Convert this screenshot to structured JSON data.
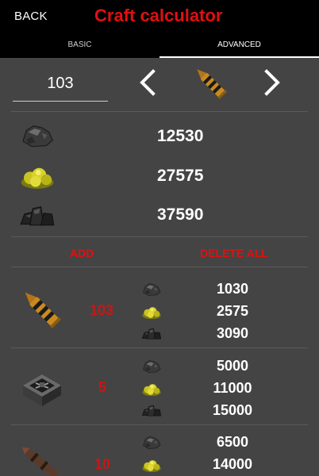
{
  "header": {
    "back_label": "BACK",
    "title": "Craft calculator",
    "tabs": [
      {
        "label": "BASIC",
        "active": false
      },
      {
        "label": "ADVANCED",
        "active": true
      }
    ]
  },
  "selector": {
    "quantity": "103",
    "item_icon": "ammo-cartridge-icon"
  },
  "totals": [
    {
      "resource_icon": "coal-ore-icon",
      "value": "12530"
    },
    {
      "resource_icon": "sulfur-icon",
      "value": "27575"
    },
    {
      "resource_icon": "charcoal-icon",
      "value": "37590"
    }
  ],
  "actions": {
    "add_label": "ADD",
    "delete_all_label": "DELETE ALL"
  },
  "craft_list": [
    {
      "item_icon": "ammo-cartridge-icon",
      "count": "103",
      "costs": [
        {
          "resource_icon": "coal-ore-icon",
          "value": "1030"
        },
        {
          "resource_icon": "sulfur-icon",
          "value": "2575"
        },
        {
          "resource_icon": "charcoal-icon",
          "value": "3090"
        }
      ]
    },
    {
      "item_icon": "explosive-charge-icon",
      "count": "5",
      "costs": [
        {
          "resource_icon": "coal-ore-icon",
          "value": "5000"
        },
        {
          "resource_icon": "sulfur-icon",
          "value": "11000"
        },
        {
          "resource_icon": "charcoal-icon",
          "value": "15000"
        }
      ]
    },
    {
      "item_icon": "rocket-icon",
      "count": "10",
      "costs": [
        {
          "resource_icon": "coal-ore-icon",
          "value": "6500"
        },
        {
          "resource_icon": "sulfur-icon",
          "value": "14000"
        }
      ]
    }
  ],
  "colors": {
    "accent_red": "#e01010",
    "background": "#444444",
    "header_background": "#000000"
  }
}
